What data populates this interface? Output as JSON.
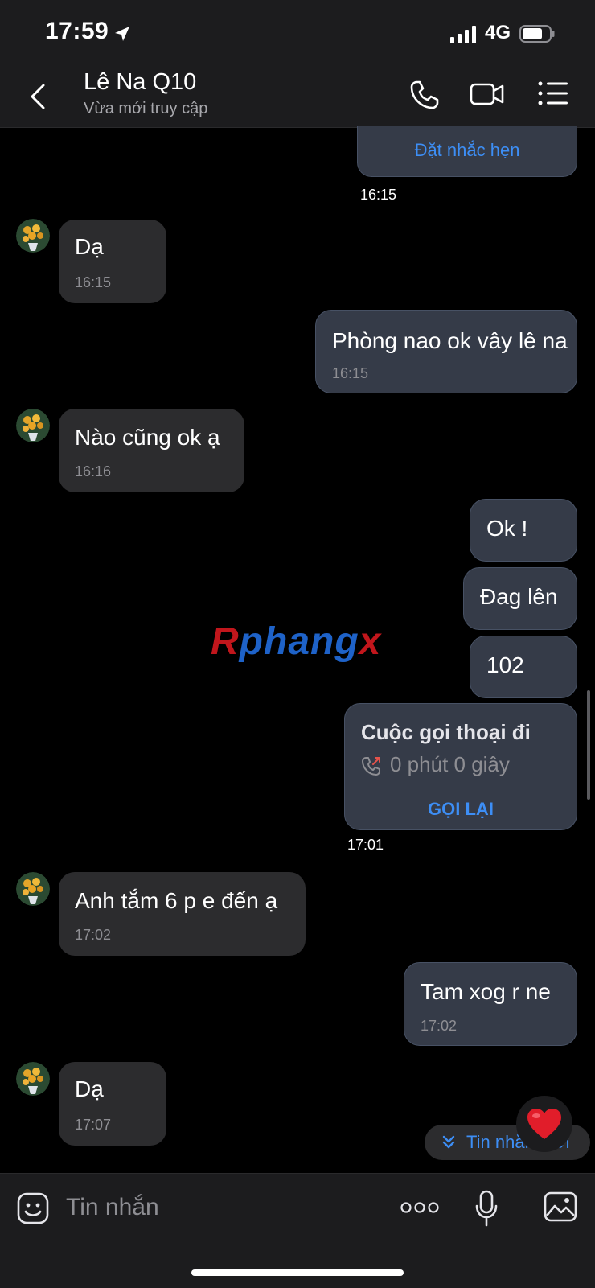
{
  "status_bar": {
    "time": "17:59",
    "network": "4G"
  },
  "header": {
    "name": "Lê Na Q10",
    "status": "Vừa mới truy cập"
  },
  "reminder": {
    "label": "Đặt nhắc hẹn"
  },
  "time_labels": [
    "16:15",
    "17:01"
  ],
  "messages": [
    {
      "text": "Dạ",
      "time": "16:15"
    },
    {
      "text": "Phòng nao ok vây lê na",
      "time": "16:15"
    },
    {
      "text": "Nào cũng ok ạ",
      "time": "16:16"
    },
    {
      "text": "Ok !"
    },
    {
      "text": "Đag lên"
    },
    {
      "text": "102"
    },
    {
      "text": "Anh tắm 6 p e đến ạ",
      "time": "17:02"
    },
    {
      "text": "Tam xog r ne",
      "time": "17:02"
    },
    {
      "text": "Dạ",
      "time": "17:07"
    }
  ],
  "call_card": {
    "title": "Cuộc gọi thoại đi",
    "duration": "0 phút 0 giây",
    "action": "GỌI LẠI"
  },
  "watermark": {
    "part1": "R",
    "part2": "phang",
    "part3": "x"
  },
  "new_messages": {
    "label": "Tin nhắn mới"
  },
  "composer": {
    "placeholder": "Tin nhắn"
  },
  "colors": {
    "accent": "#3d8ef5",
    "incoming": "#2c2c2e",
    "outgoing": "#353b48",
    "background": "#000000"
  }
}
